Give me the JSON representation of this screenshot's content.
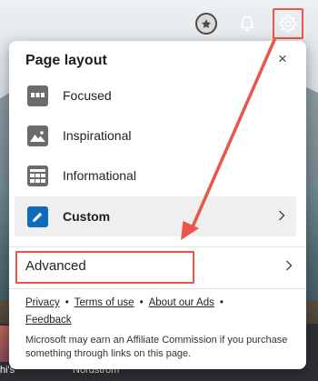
{
  "toolbar": {
    "rewards_icon": "rewards-medal-icon",
    "notifications_icon": "bell-icon",
    "settings_icon": "gear-icon"
  },
  "panel": {
    "title": "Page layout",
    "close_glyph": "×",
    "layouts": [
      {
        "label": "Focused",
        "icon": "focused-layout-icon"
      },
      {
        "label": "Inspirational",
        "icon": "inspirational-layout-icon"
      },
      {
        "label": "Informational",
        "icon": "informational-layout-icon"
      },
      {
        "label": "Custom",
        "icon": "custom-layout-pencil-icon",
        "selected": true
      }
    ],
    "advanced": {
      "label": "Advanced"
    },
    "links": {
      "privacy": "Privacy",
      "terms": "Terms of use",
      "ads": "About our Ads",
      "feedback": "Feedback"
    },
    "disclaimer": "Microsoft may earn an Affiliate Commission if you purchase something through links on this page."
  },
  "background": {
    "label_left": "hi's",
    "label_mid": "Nordstrom"
  },
  "colors": {
    "annotation": "#e8574a",
    "accent": "#0f6cbd",
    "selected_row": "#efefef"
  }
}
